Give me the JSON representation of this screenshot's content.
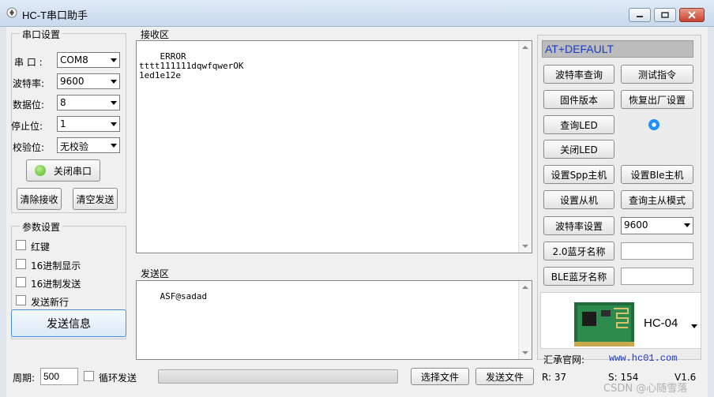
{
  "window": {
    "title": "HC-T串口助手"
  },
  "serial_settings": {
    "title": "串口设置",
    "port_label": "串 口   :",
    "port_value": "COM8",
    "baud_label": "波特率:",
    "baud_value": "9600",
    "databits_label": "数据位:",
    "databits_value": "8",
    "stopbits_label": "停止位:",
    "stopbits_value": "1",
    "parity_label": "校验位:",
    "parity_value": "无校验",
    "close_port_label": "关闭串口",
    "clear_receive_label": "清除接收",
    "clear_send_label": "清空发送"
  },
  "params": {
    "title": "参数设置",
    "opt1": "红键",
    "opt2": "16进制显示",
    "opt3": "16进制发送",
    "opt4": "发送新行",
    "send_button": "发送信息"
  },
  "receive": {
    "title": "接收区",
    "text": "ERROR\ntttt111111dqwfqwerOK\n1ed1e12e"
  },
  "send": {
    "title": "发送区",
    "text": "ASF@sadad"
  },
  "bottom": {
    "period_label": "周期:",
    "period_value": "500",
    "loop_send_label": "循环发送",
    "choose_file_label": "选择文件",
    "send_file_label": "发送文件",
    "r_count": "R: 37",
    "s_count": "S: 154",
    "version": "V1.6",
    "watermark": "CSDN @心随雪落"
  },
  "right_panel": {
    "at_text": "AT+DEFAULT",
    "btn_query_baud": "波特率查询",
    "btn_test_cmd": "测试指令",
    "btn_firmware": "固件版本",
    "btn_factory_reset": "恢复出厂设置",
    "btn_query_led": "查询LED",
    "btn_close_led": "关闭LED",
    "btn_set_spp_master": "设置Spp主机",
    "btn_set_ble_master": "设置Ble主机",
    "btn_set_slave": "设置从机",
    "btn_query_mode": "查询主从模式",
    "btn_baud_set": "波特率设置",
    "baud_set_value": "9600",
    "btn_bt20_name": "2.0蓝牙名称",
    "btn_ble_name": "BLE蓝牙名称",
    "module_name": "HC-04",
    "website_label": "汇承官网:",
    "website": "www.hc01.com",
    "led_color": "#1e90ff"
  }
}
